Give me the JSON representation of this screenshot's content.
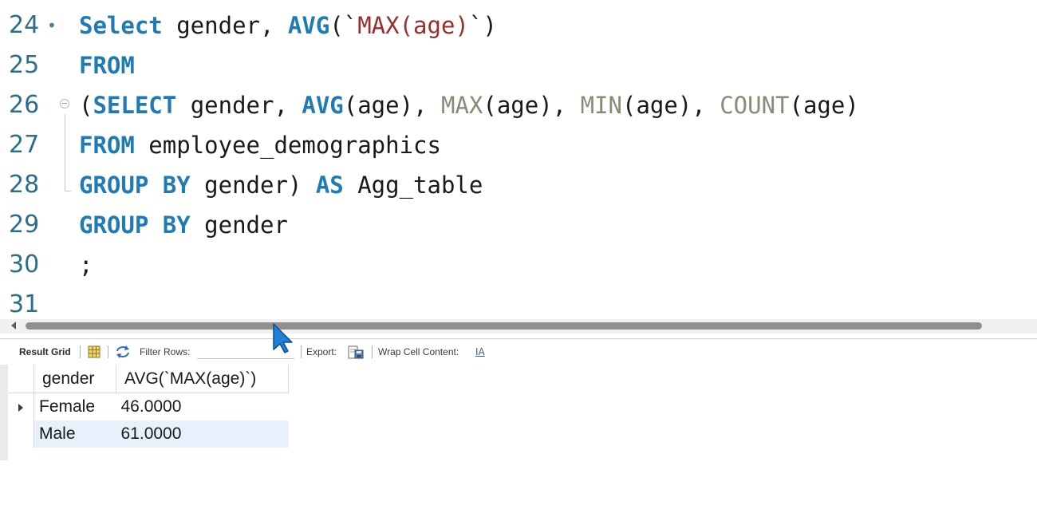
{
  "editor": {
    "lines": [
      {
        "num": "24",
        "marker": "•",
        "tokens": [
          {
            "t": "Select",
            "c": "kw"
          },
          {
            "t": " gender, ",
            "c": "plain"
          },
          {
            "t": "AVG",
            "c": "fn"
          },
          {
            "t": "(`",
            "c": "plain"
          },
          {
            "t": "MAX(age)",
            "c": "str"
          },
          {
            "t": "`)",
            "c": "plain"
          }
        ]
      },
      {
        "num": "25",
        "marker": "",
        "tokens": [
          {
            "t": "FROM",
            "c": "kw"
          }
        ]
      },
      {
        "num": "26",
        "marker": "",
        "fold": true,
        "tokens": [
          {
            "t": "(",
            "c": "plain"
          },
          {
            "t": "SELECT",
            "c": "kw"
          },
          {
            "t": " gender, ",
            "c": "plain"
          },
          {
            "t": "AVG",
            "c": "fn"
          },
          {
            "t": "(age), ",
            "c": "plain"
          },
          {
            "t": "MAX",
            "c": "fn2"
          },
          {
            "t": "(age), ",
            "c": "plain"
          },
          {
            "t": "MIN",
            "c": "fn2"
          },
          {
            "t": "(age), ",
            "c": "plain"
          },
          {
            "t": "COUNT",
            "c": "fn2"
          },
          {
            "t": "(age)",
            "c": "plain"
          }
        ]
      },
      {
        "num": "27",
        "marker": "",
        "tokens": [
          {
            "t": "FROM",
            "c": "kw"
          },
          {
            "t": " employee_demographics",
            "c": "plain"
          }
        ]
      },
      {
        "num": "28",
        "marker": "",
        "tokens": [
          {
            "t": "GROUP BY",
            "c": "kw"
          },
          {
            "t": " gender) ",
            "c": "plain"
          },
          {
            "t": "AS",
            "c": "kw"
          },
          {
            "t": " Agg_table",
            "c": "plain"
          }
        ]
      },
      {
        "num": "29",
        "marker": "",
        "tokens": [
          {
            "t": "GROUP BY",
            "c": "kw"
          },
          {
            "t": " gender",
            "c": "plain"
          }
        ]
      },
      {
        "num": "30",
        "marker": "",
        "tokens": [
          {
            "t": ";",
            "c": "plain"
          }
        ]
      },
      {
        "num": "31",
        "marker": "",
        "tokens": []
      }
    ]
  },
  "toolbar": {
    "result_grid_label": "Result Grid",
    "filter_label": "Filter Rows:",
    "filter_value": "",
    "export_label": "Export:",
    "wrap_label": "Wrap Cell Content:",
    "wrap_icon_glyph": "IA"
  },
  "results": {
    "columns": [
      "gender",
      "AVG(`MAX(age)`)"
    ],
    "rows": [
      [
        "Female",
        "46.0000"
      ],
      [
        "Male",
        "61.0000"
      ]
    ],
    "selected_row_index": 0
  },
  "colors": {
    "keyword": "#1e7bb5",
    "string": "#9b2d2d",
    "aggregate_dim": "#8a8a75",
    "line_number": "#2b6f8e",
    "row_highlight": "#e8f0fb",
    "cursor": "#1f7fd6"
  },
  "icons": {
    "grid": "grid-icon",
    "refresh": "refresh-icon",
    "export": "export-save-icon",
    "wrap": "wrap-cell-icon",
    "fold": "fold-collapse-icon",
    "cursor": "mouse-pointer-icon"
  }
}
